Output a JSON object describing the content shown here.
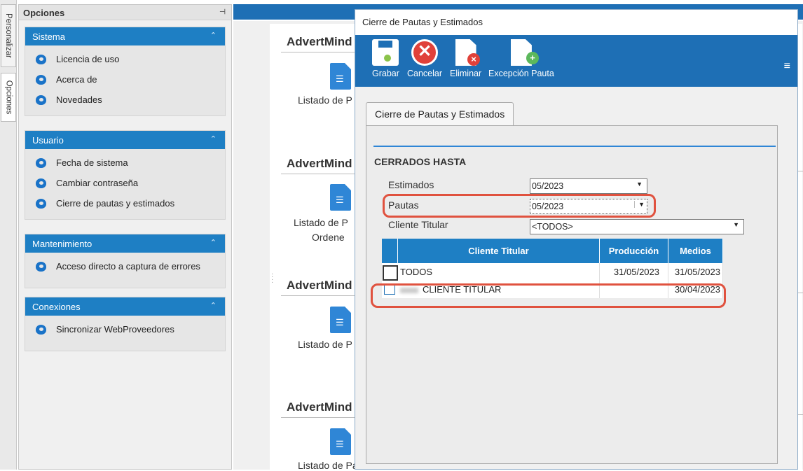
{
  "side_tabs": [
    "Personalizar",
    "Opciones"
  ],
  "options_panel": {
    "title": "Opciones",
    "groups": [
      {
        "title": "Sistema",
        "items": [
          "Licencia de uso",
          "Acerca de",
          "Novedades"
        ]
      },
      {
        "title": "Usuario",
        "items": [
          "Fecha de sistema",
          "Cambiar contraseña",
          "Cierre de pautas y estimados"
        ]
      },
      {
        "title": "Mantenimiento",
        "items": [
          "Acceso directo a captura de errores"
        ]
      },
      {
        "title": "Conexiones",
        "items": [
          "Sincronizar WebProveedores"
        ]
      }
    ]
  },
  "background": {
    "sections": [
      {
        "title": "AdvertMind",
        "item": "Listado de P"
      },
      {
        "title": "AdvertMind",
        "item": "Listado de P",
        "item2": "Ordene"
      },
      {
        "title": "AdvertMind",
        "item": "Listado de P"
      },
      {
        "title": "AdvertMind",
        "item": "Listado de Pautas"
      }
    ]
  },
  "dialog": {
    "title": "Cierre de Pautas y Estimados",
    "toolbar": {
      "save": "Grabar",
      "cancel": "Cancelar",
      "delete": "Eliminar",
      "exception": "Excepción Pauta"
    },
    "tab_label": "Cierre de Pautas y Estimados",
    "section_label": "CERRADOS HASTA",
    "fields": {
      "estimados_label": "Estimados",
      "estimados_value": "05/2023",
      "pautas_label": "Pautas",
      "pautas_value": "05/2023",
      "cliente_label": "Cliente Titular",
      "cliente_value": "<TODOS>"
    },
    "grid": {
      "columns": [
        "Cliente Titular",
        "Producción",
        "Medios"
      ],
      "rows": [
        {
          "cliente": "TODOS",
          "produccion": "31/05/2023",
          "medios": "31/05/2023"
        },
        {
          "cliente": "CLIENTE TITULAR",
          "produccion": "",
          "medios": "30/04/2023"
        }
      ]
    }
  },
  "colors": {
    "accent": "#1e6fb5",
    "header_blue": "#1e7fc4",
    "highlight_red": "#e0523f"
  }
}
